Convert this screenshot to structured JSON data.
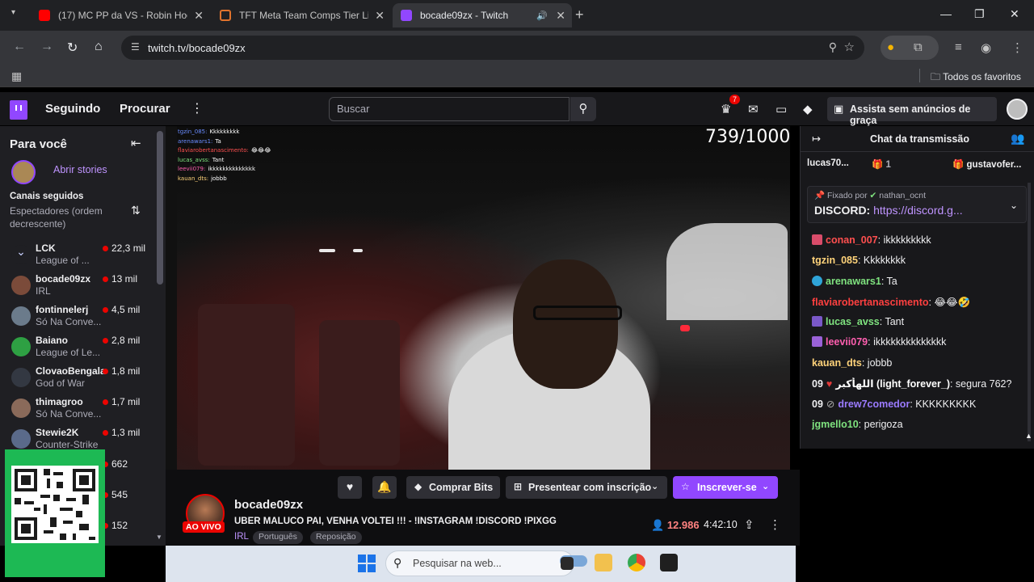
{
  "browser": {
    "tabs": [
      {
        "title": "(17) MC PP da VS - Robin Hood",
        "favicon": "youtube-icon",
        "color": "#ff0000"
      },
      {
        "title": "TFT Meta Team Comps Tier List",
        "favicon": "tft-icon",
        "color": "#e0732d"
      },
      {
        "title": "bocade09zx - Twitch",
        "favicon": "twitch-icon",
        "color": "#9147ff"
      }
    ],
    "url": "twitch.tv/bocade09zx",
    "bookmarks_folder": "Todos os favoritos"
  },
  "twitch_nav": {
    "following": "Seguindo",
    "browse": "Procurar",
    "search_placeholder": "Buscar",
    "notification_count": "7",
    "prime_label": "Assista sem anúncios de graça"
  },
  "sidebar": {
    "heading": "Para você",
    "stories_label": "Abrir stories",
    "followed_heading": "Canais seguidos",
    "sort_label": "Espectadores (ordem decrescente)",
    "channels": [
      {
        "name": "LCK",
        "game": "League of ...",
        "viewers": "22,3 mil",
        "color": "#1f1f23"
      },
      {
        "name": "bocade09zx",
        "game": "IRL",
        "viewers": "13 mil",
        "color": "#7b4b3a"
      },
      {
        "name": "fontinnelerj",
        "game": "Só Na Conve...",
        "viewers": "4,5 mil",
        "color": "#6b7b8b"
      },
      {
        "name": "Baiano",
        "game": "League of Le...",
        "viewers": "2,8 mil",
        "color": "#2ea043"
      },
      {
        "name": "ClovaoBengala",
        "game": "God of War",
        "viewers": "1,8 mil",
        "color": "#333842"
      },
      {
        "name": "thimagroo",
        "game": "Só Na Conve...",
        "viewers": "1,7 mil",
        "color": "#8a6a5a"
      },
      {
        "name": "Stewie2K",
        "game": "Counter-Strike",
        "viewers": "1,3 mil",
        "color": "#5a6a8a"
      },
      {
        "name": "",
        "game": "",
        "viewers": "662",
        "color": "#1db954"
      },
      {
        "name": "",
        "game": "",
        "viewers": "545",
        "color": "#1db954"
      },
      {
        "name": "",
        "game": "",
        "viewers": "152",
        "color": "#1db954"
      }
    ]
  },
  "video": {
    "counter": "739/1000",
    "overlay_chat": [
      {
        "user": "tgzin_085:",
        "text": "Kkkkkkkkk"
      },
      {
        "user": "arenawars1:",
        "text": "Ta"
      },
      {
        "user": "flaviarobertanascimento:",
        "text": "😂😂😂"
      },
      {
        "user": "lucas_avss:",
        "text": "Tant"
      },
      {
        "user": "leevii079:",
        "text": "ikkkkkkkkkkkkkk"
      },
      {
        "user": "kauan_dts:",
        "text": "jobbb"
      }
    ]
  },
  "stream_info": {
    "buy_bits": "Comprar Bits",
    "gift_sub": "Presentear com inscrição",
    "subscribe": "Inscrever-se",
    "live_badge": "AO VIVO",
    "streamer": "bocade09zx",
    "title": "UBER MALUCO PAI, VENHA VOLTEI !!! - !INSTAGRAM !DISCORD !PIXGG",
    "category": "IRL",
    "tags": [
      "Português",
      "Reposição"
    ],
    "viewers": "12.986",
    "uptime": "4:42:10"
  },
  "chat": {
    "title": "Chat da transmissão",
    "gifters": [
      {
        "name": "lucas70...",
        "count": "1"
      },
      {
        "name": "gustavofer...",
        "count": ""
      }
    ],
    "pinned_by": "Fixado por",
    "pinned_user": "nathan_ocnt",
    "pinned_prefix": "DISCORD:",
    "pinned_link": "https://discord.g...",
    "messages": [
      {
        "user": "conan_007",
        "text": ": ikkkkkkkkk",
        "color": "#ff4f4f",
        "badge": "#d94c6a"
      },
      {
        "user": "tgzin_085",
        "text": ": Kkkkkkkk",
        "color": "#ffd37a",
        "badge": ""
      },
      {
        "user": "arenawars1",
        "text": ": Ta",
        "color": "#7fe37f",
        "badge": "#2fa4d8"
      },
      {
        "user": "flaviarobertanascimento",
        "text": ": 😂😂🤣",
        "color": "#ff4040",
        "badge": ""
      },
      {
        "user": "lucas_avss",
        "text": ": Tant",
        "color": "#7fe37f",
        "badge": "#7a58c8"
      },
      {
        "user": "leevii079",
        "text": ": ikkkkkkkkkkkkkk",
        "color": "#ff5fb0",
        "badge": "#9a62d8"
      },
      {
        "user": "kauan_dts",
        "text": ": jobbb",
        "color": "#ffd37a",
        "badge": ""
      },
      {
        "user": "اللهأكبر (light_forever_)",
        "text": ": segura 762?",
        "color": "#ffffff",
        "badge": "#e03a3a",
        "prefix": "09"
      },
      {
        "user": "drew7comedor",
        "text": ": KKKKKKKKK",
        "color": "#9b7bff",
        "badge": "#555",
        "prefix": "09"
      },
      {
        "user": "jgmello10",
        "text": ": perigoza",
        "color": "#7fe37f",
        "badge": ""
      }
    ]
  },
  "taskbar": {
    "search_placeholder": "Pesquisar na web..."
  }
}
